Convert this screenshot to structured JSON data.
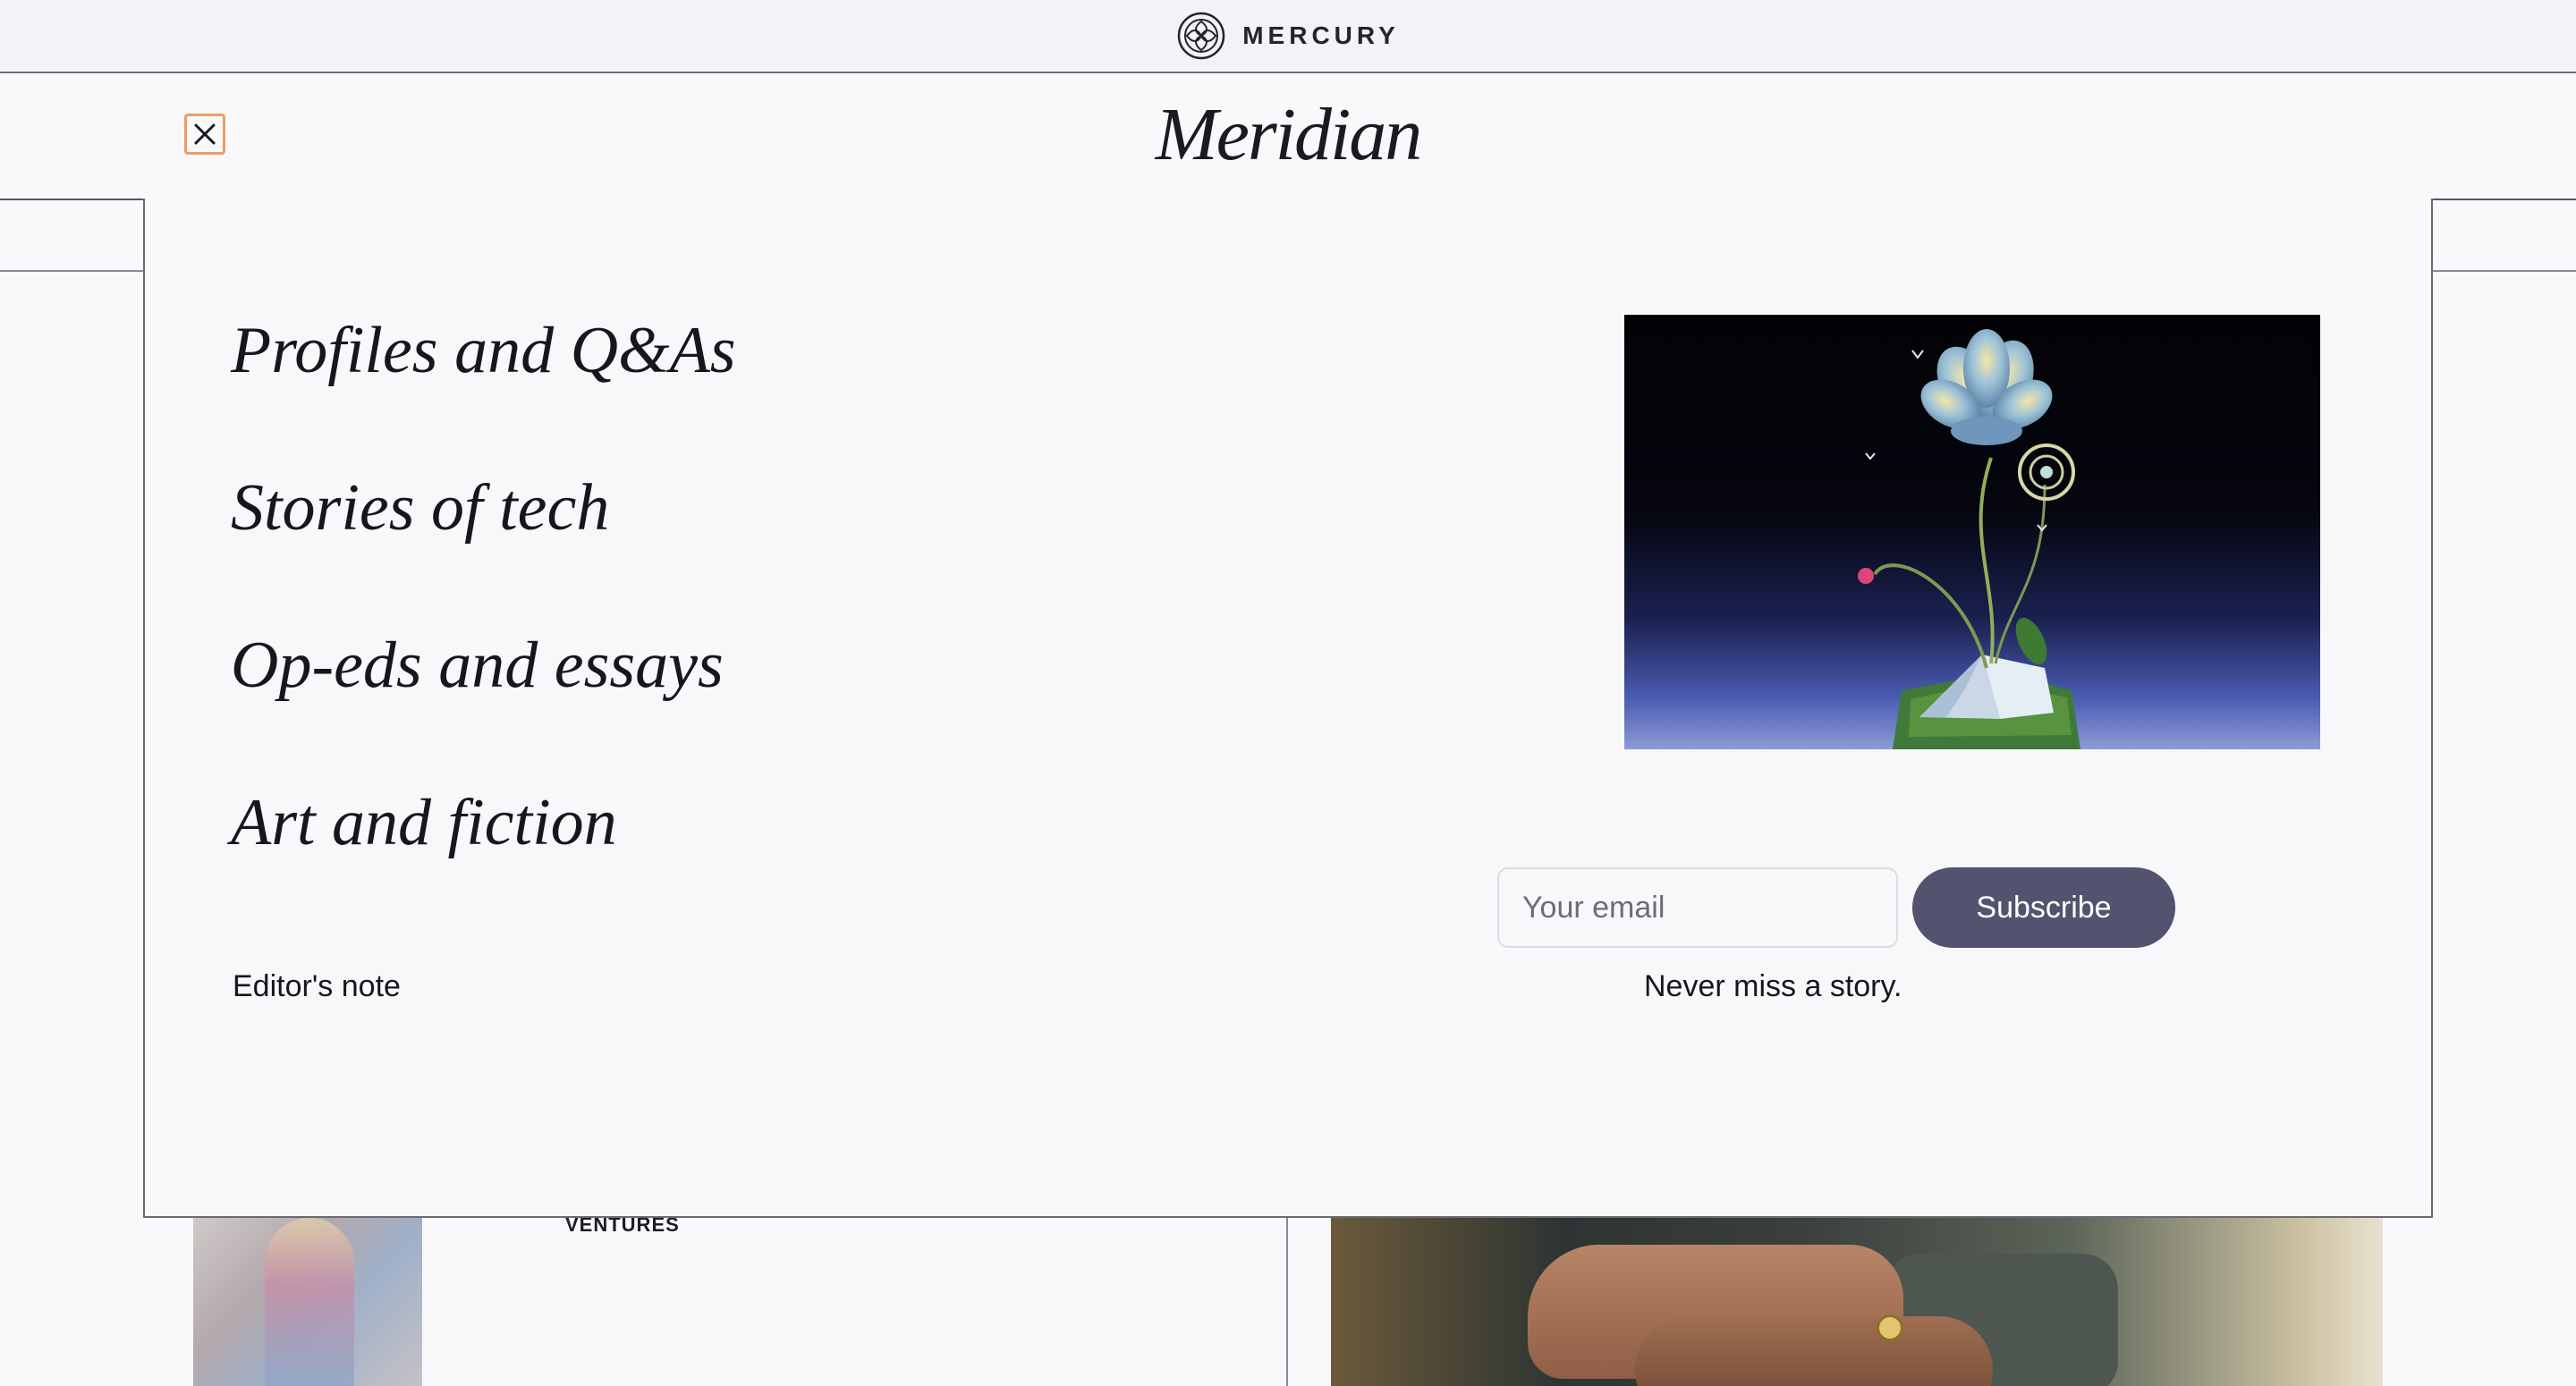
{
  "topbar": {
    "brand": "MERCURY",
    "logo_icon": "mercury-logo-icon"
  },
  "header": {
    "wordmark": "Meridian",
    "close_icon": "close-icon",
    "accent_color": "#ef9d62"
  },
  "menu": {
    "nav_items": [
      {
        "label": "Profiles and Q&As"
      },
      {
        "label": "Stories of tech"
      },
      {
        "label": "Op-eds and essays"
      },
      {
        "label": "Art and fiction"
      }
    ],
    "editor_note": "Editor's note",
    "feature_image_icon": "flower-book-illustration"
  },
  "newsletter": {
    "heading": "Never miss a story.",
    "email_placeholder": "Your email",
    "email_value": "",
    "subscribe_label": "Subscribe",
    "button_color": "#535370"
  },
  "background": {
    "tag": "VENTURES"
  }
}
